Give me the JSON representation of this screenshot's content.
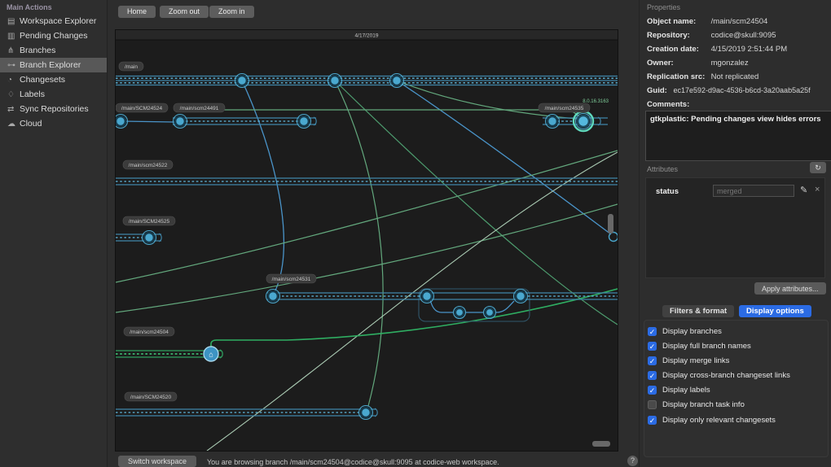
{
  "sidebar": {
    "header": "Main Actions",
    "items": [
      {
        "name": "workspace-explorer",
        "label": "Workspace Explorer",
        "icon_glyph": "▤",
        "selected": false
      },
      {
        "name": "pending-changes",
        "label": "Pending Changes",
        "icon_glyph": "▥",
        "selected": false
      },
      {
        "name": "branches",
        "label": "Branches",
        "icon_glyph": "⋔",
        "selected": false
      },
      {
        "name": "branch-explorer",
        "label": "Branch Explorer",
        "icon_glyph": "⊶",
        "selected": true
      },
      {
        "name": "changesets",
        "label": "Changesets",
        "icon_glyph": "◔",
        "selected": false
      },
      {
        "name": "labels",
        "label": "Labels",
        "icon_glyph": "♢",
        "selected": false
      },
      {
        "name": "sync-repositories",
        "label": "Sync Repositories",
        "icon_glyph": "⇄",
        "selected": false
      },
      {
        "name": "cloud",
        "label": "Cloud",
        "icon_glyph": "☁",
        "selected": false
      }
    ]
  },
  "toolbar": {
    "home": "Home",
    "zoom_out": "Zoom out",
    "zoom_in": "Zoom in"
  },
  "canvas": {
    "date_header": "4/17/2019",
    "version_label": "8.0.16.3163",
    "branches": [
      "/main",
      "/main/SCM24524",
      "/main/scm24491",
      "/main/scm24535",
      "/main/scm24522",
      "/main/SCM24525",
      "/main/scm24531",
      "/main/scm24504",
      "/main/SCM24520"
    ],
    "home_icon_glyph": "⌂"
  },
  "properties": {
    "title": "Properties",
    "fields": [
      {
        "label": "Object name:",
        "value": "/main/scm24504"
      },
      {
        "label": "Repository:",
        "value": "codice@skull:9095"
      },
      {
        "label": "Creation date:",
        "value": "4/15/2019 2:51:44 PM"
      },
      {
        "label": "Owner:",
        "value": "mgonzalez"
      },
      {
        "label": "Replication src:",
        "value": "Not replicated"
      },
      {
        "label": "Guid:",
        "value": "ec17e592-d9ac-4536-b6cd-3a20aab5a25f"
      }
    ],
    "comments_label": "Comments:",
    "comments_text": "gtkplastic: Pending changes view hides errors"
  },
  "attributes": {
    "title": "Attributes",
    "refresh_glyph": "↻",
    "row": {
      "name": "status",
      "value_placeholder": "merged",
      "edit_glyph": "✎",
      "delete_glyph": "×"
    },
    "apply_label": "Apply attributes..."
  },
  "tabs": {
    "filters_format": "Filters & format",
    "display_options": "Display options"
  },
  "display_options": {
    "items": [
      {
        "label": "Display branches",
        "checked": true
      },
      {
        "label": "Display full branch names",
        "checked": true
      },
      {
        "label": "Display merge links",
        "checked": true
      },
      {
        "label": "Display cross-branch changeset links",
        "checked": true
      },
      {
        "label": "Display labels",
        "checked": true
      },
      {
        "label": "Display branch task info",
        "checked": false
      },
      {
        "label": "Display only relevant changesets",
        "checked": true
      }
    ]
  },
  "statusbar": {
    "switch_label": "Switch workspace",
    "message": "You are browsing branch /main/scm24504@codice@skull:9095 at codice-web workspace.",
    "help_glyph": "?"
  }
}
